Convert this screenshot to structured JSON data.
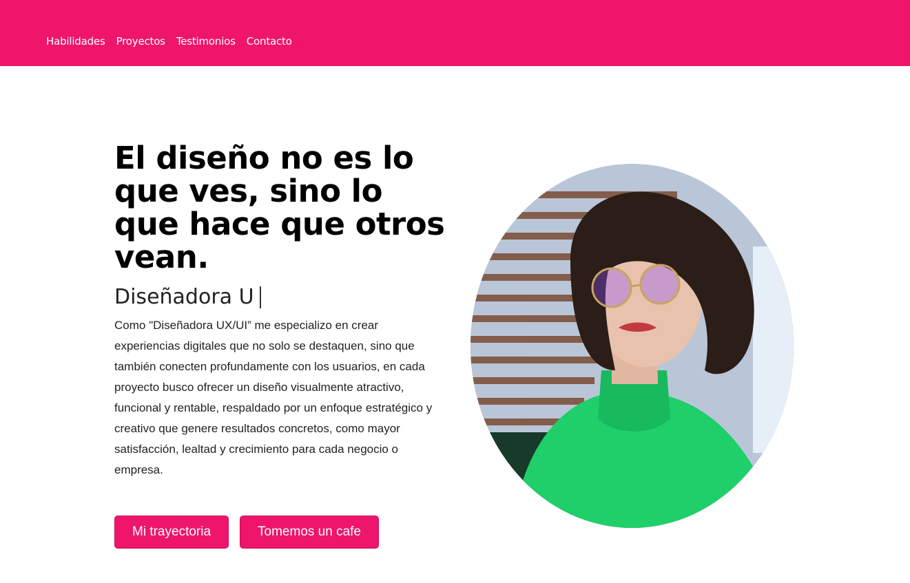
{
  "nav": {
    "items": [
      "Habilidades",
      "Proyectos",
      "Testimonios",
      "Contacto"
    ]
  },
  "hero": {
    "headline": "El diseño no es lo que ves, sino lo que hace que otros vean.",
    "role": "Diseñadora U",
    "bio": "Como \"Diseñadora UX/UI” me especializo en crear experiencias digitales que no solo se destaquen, sino que también conecten profundamente con los usuarios, en cada proyecto busco ofrecer un diseño visualmente atractivo, funcional y rentable, respaldado por un enfoque estratégico y creativo que genere resultados concretos, como mayor satisfacción, lealtad y crecimiento para cada negocio o empresa.",
    "buttons": {
      "primary": "Mi trayectoria",
      "secondary": "Tomemos un cafe"
    }
  },
  "colors": {
    "brand": "#ee156b",
    "text": "#222222",
    "background": "#ffffff"
  }
}
